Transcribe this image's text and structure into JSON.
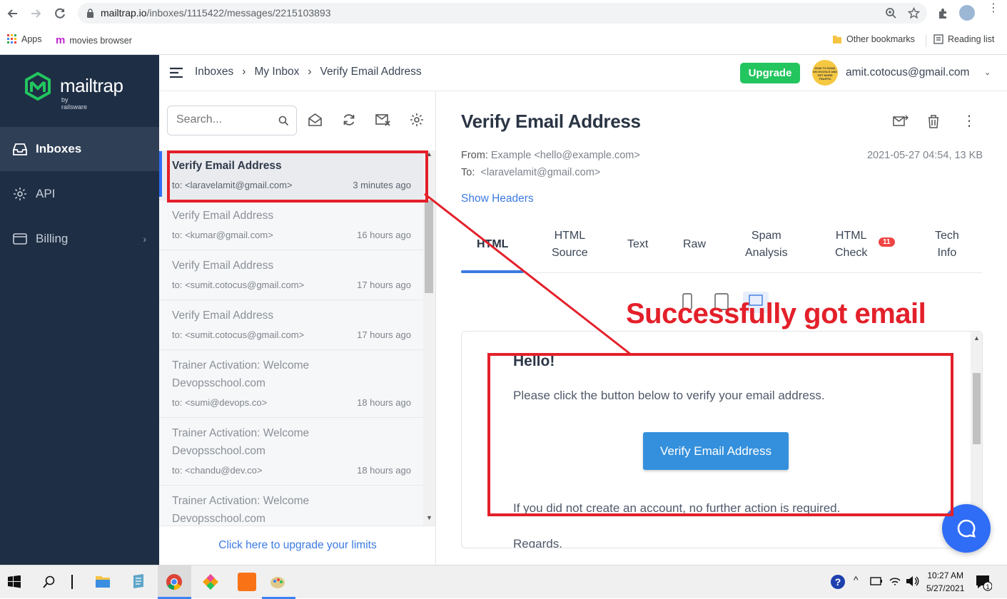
{
  "browser": {
    "url_host": "mailtrap.io",
    "url_path": "/inboxes/1115422/messages/2215103893",
    "bookmarks": {
      "apps": "Apps",
      "movies": "movies browser",
      "other": "Other bookmarks",
      "reading": "Reading list"
    }
  },
  "sidebar": {
    "brand": "mailtrap",
    "brand_sub": "by railsware",
    "items": [
      {
        "label": "Inboxes",
        "icon": "inbox-icon",
        "active": true
      },
      {
        "label": "API",
        "icon": "gear-icon",
        "active": false
      },
      {
        "label": "Billing",
        "icon": "card-icon",
        "active": false
      }
    ]
  },
  "header": {
    "breadcrumb": [
      "Inboxes",
      "My Inbox",
      "Verify Email Address"
    ],
    "upgrade_label": "Upgrade",
    "avatar_text": "HOW TO RANK ON GOOGLE AND GET MORE TRAFFIC",
    "user_email": "amit.cotocus@gmail.com"
  },
  "list": {
    "search_placeholder": "Search...",
    "messages": [
      {
        "subject": "Verify Email Address",
        "to": "to: <laravelamit@gmail.com>",
        "time": "3 minutes ago",
        "selected": true
      },
      {
        "subject": "Verify Email Address",
        "to": "to: <kumar@gmail.com>",
        "time": "16 hours ago"
      },
      {
        "subject": "Verify Email Address",
        "to": "to: <sumit.cotocus@gmail.com>",
        "time": "17 hours ago"
      },
      {
        "subject": "Verify Email Address",
        "to": "to: <sumit.cotocus@gmail.com>",
        "time": "17 hours ago"
      },
      {
        "subject": "Trainer Activation: Welcome Devopsschool.com",
        "to": "to: <sumi@devops.co>",
        "time": "18 hours ago"
      },
      {
        "subject": "Trainer Activation: Welcome Devopsschool.com",
        "to": "to: <chandu@dev.co>",
        "time": "18 hours ago"
      },
      {
        "subject": "Trainer Activation: Welcome Devopsschool.com",
        "to": "",
        "time": ""
      }
    ],
    "upgrade_link": "Click here to upgrade your limits"
  },
  "email": {
    "title": "Verify Email Address",
    "from_label": "From:",
    "from_value": "Example <hello@example.com>",
    "to_label": "To:",
    "to_value": "<laravelamit@gmail.com>",
    "meta": "2021-05-27 04:54, 13 KB",
    "show_headers": "Show Headers",
    "tabs": [
      {
        "line1": "HTML",
        "line2": "",
        "active": true
      },
      {
        "line1": "HTML",
        "line2": "Source"
      },
      {
        "line1": "Text",
        "line2": ""
      },
      {
        "line1": "Raw",
        "line2": ""
      },
      {
        "line1": "Spam",
        "line2": "Analysis"
      },
      {
        "line1": "HTML",
        "line2": "Check",
        "badge": "11"
      },
      {
        "line1": "Tech",
        "line2": "Info"
      }
    ],
    "body": {
      "greeting": "Hello!",
      "line1": "Please click the button below to verify your email address.",
      "button": "Verify Email Address",
      "line2": "If you did not create an account, no further action is required.",
      "line3": "Regards,"
    }
  },
  "annotation": {
    "text": "Successfully got email",
    "color": "#e3202a"
  },
  "taskbar": {
    "time": "10:27 AM",
    "date": "5/27/2021"
  },
  "colors": {
    "sidebar_bg": "#1e2e45",
    "accent_blue": "#3c7ae0",
    "upgrade_green": "#22c55e",
    "brand_green": "#22c55e"
  }
}
